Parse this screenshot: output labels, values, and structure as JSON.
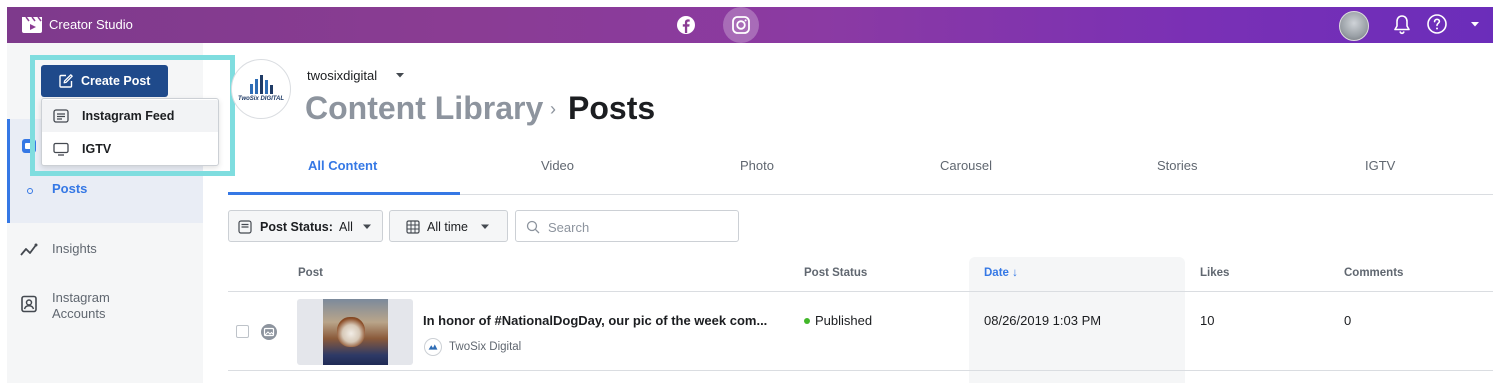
{
  "app": {
    "title": "Creator Studio"
  },
  "topbar": {
    "platforms": [
      {
        "name": "facebook-icon",
        "active": false
      },
      {
        "name": "instagram-icon",
        "active": true
      }
    ],
    "right_icons": [
      "avatar",
      "bell-icon",
      "help-icon",
      "caret-down-icon"
    ]
  },
  "create_post": {
    "label": "Create Post",
    "menu": [
      {
        "label": "Instagram Feed",
        "icon": "feed-icon"
      },
      {
        "label": "IGTV",
        "icon": "tv-icon"
      }
    ]
  },
  "sidebar": {
    "items": [
      {
        "label": "Posts",
        "active": true
      },
      {
        "label": "Insights",
        "icon": "insights-icon"
      },
      {
        "label": "Instagram Accounts",
        "icon": "accounts-icon"
      }
    ]
  },
  "header": {
    "account": "twosixdigital",
    "avatar_text": "TwoSix DIGITAL",
    "breadcrumb": [
      "Content Library",
      "Posts"
    ]
  },
  "tabs": [
    "All Content",
    "Video",
    "Photo",
    "Carousel",
    "Stories",
    "IGTV"
  ],
  "filters": {
    "post_status_label": "Post Status:",
    "post_status_value": "All",
    "time_value": "All time",
    "search_placeholder": "Search"
  },
  "table": {
    "columns": [
      "Post",
      "Post Status",
      "Date ↓",
      "Likes",
      "Comments"
    ],
    "rows": [
      {
        "title": "In honor of #NationalDogDay, our pic of the week com...",
        "source": "TwoSix Digital",
        "status": "Published",
        "date": "08/26/2019 1:03 PM",
        "likes": "10",
        "comments": "0"
      }
    ]
  },
  "colors": {
    "accent": "#3578e5",
    "create_button": "#1f4a8b",
    "highlight": "#7fdddf",
    "published": "#42b72a"
  }
}
